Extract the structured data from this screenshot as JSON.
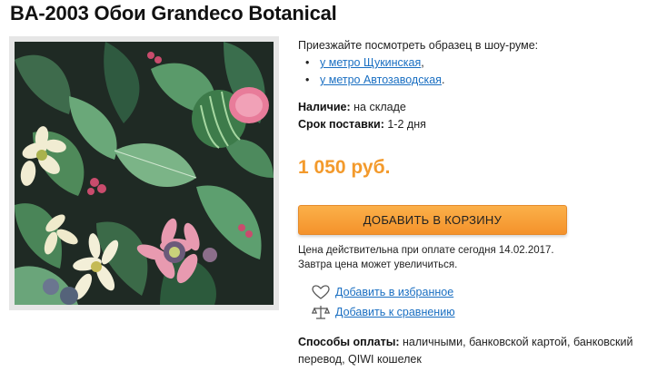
{
  "product": {
    "title": "BA-2003 Обои Grandeco Botanical",
    "image_alt": "Обои Grandeco Botanical"
  },
  "showroom": {
    "text": "Приезжайте посмотреть образец в шоу-руме:",
    "locations": [
      {
        "label": "у метро Щукинская",
        "suffix": ","
      },
      {
        "label": "у метро Автозаводская",
        "suffix": "."
      }
    ]
  },
  "availability": {
    "label": "Наличие:",
    "value": "на складе"
  },
  "delivery": {
    "label": "Срок поставки:",
    "value": "1-2 дня"
  },
  "price": "1 050 руб.",
  "cart_button": "ДОБАВИТЬ В КОРЗИНУ",
  "price_note": {
    "line1": "Цена действительна при оплате сегодня 14.02.2017.",
    "line2": "Завтра цена может увеличиться."
  },
  "actions": {
    "favorites": {
      "label": "Добавить в избранное",
      "icon": "heart-icon"
    },
    "compare": {
      "label": "Добавить к сравнению",
      "icon": "scales-icon"
    }
  },
  "payment": {
    "label": "Способы оплаты:",
    "value": "наличными, банковской картой, банковский перевод, QIWI кошелек"
  },
  "colors": {
    "accent": "#f39a2c",
    "link": "#1a6fc2",
    "button": "#f4922b"
  }
}
